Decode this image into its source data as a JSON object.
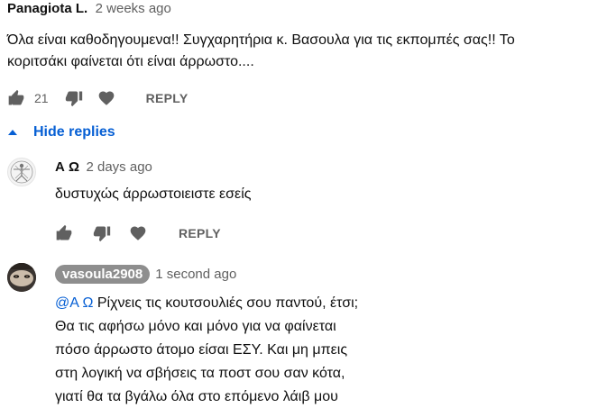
{
  "comment": {
    "author": "Panagiota L.",
    "time": "2 weeks ago",
    "text_line1": "Όλα είναι καθοδηγουμενα!! Συγχαρητήρια κ. Βασουλα για τις εκπομπές σας!! Το",
    "text_line2": "κοριτσάκι φαίνεται ότι είναι άρρωστο....",
    "likes": "21",
    "reply_label": "REPLY"
  },
  "replies_toggle": {
    "label": "Hide replies"
  },
  "reply1": {
    "author": "Α Ω",
    "time": "2 days ago",
    "text": "δυστυχώς άρρωστοιειστε εσείς",
    "reply_label": "REPLY"
  },
  "reply2": {
    "author": "vasoula2908",
    "time": "1 second ago",
    "mention": "@Α Ω",
    "line1_rest": " Ρίχνεις τις κουτσουλιές σου παντού, έτσι;",
    "line2": "Θα τις αφήσω μόνο και μόνο για να φαίνεται",
    "line3": "πόσο άρρωστο άτομο είσαι ΕΣΥ. Και μη μπεις",
    "line4": "στη λογική να σβήσεις τα ποστ σου σαν κότα,",
    "line5": "γιατί θα τα βγάλω όλα στο επόμενο λάιβ μου"
  },
  "icons": {
    "like": "thumbs-up-icon",
    "dislike": "thumbs-down-icon",
    "heart": "heart-icon",
    "collapse": "caret-up-icon"
  },
  "colors": {
    "link": "#065fd4",
    "muted": "#606060",
    "chip": "#8e8e8e"
  }
}
